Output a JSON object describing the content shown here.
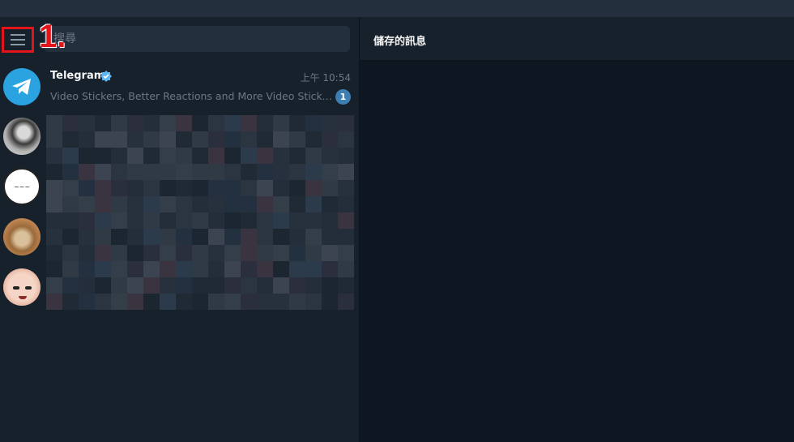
{
  "annotation": {
    "step_label": "1."
  },
  "search": {
    "placeholder": "搜尋"
  },
  "chats": [
    {
      "name": "Telegram",
      "verified": true,
      "time": "上午 10:54",
      "preview": "Video Stickers, Better Reactions and More  Video Stickers and More",
      "unread": "1"
    }
  ],
  "chat_panel": {
    "title": "儲存的訊息"
  },
  "colors": {
    "accent": "#2aa3e0",
    "badge": "#3f7eb1",
    "annotation_red": "#e3141a",
    "sidebar_bg": "#17212b",
    "chat_bg": "#0e1621"
  },
  "icons": {
    "menu": "hamburger-icon",
    "verified": "verified-badge-icon",
    "telegram": "telegram-plane-icon"
  }
}
